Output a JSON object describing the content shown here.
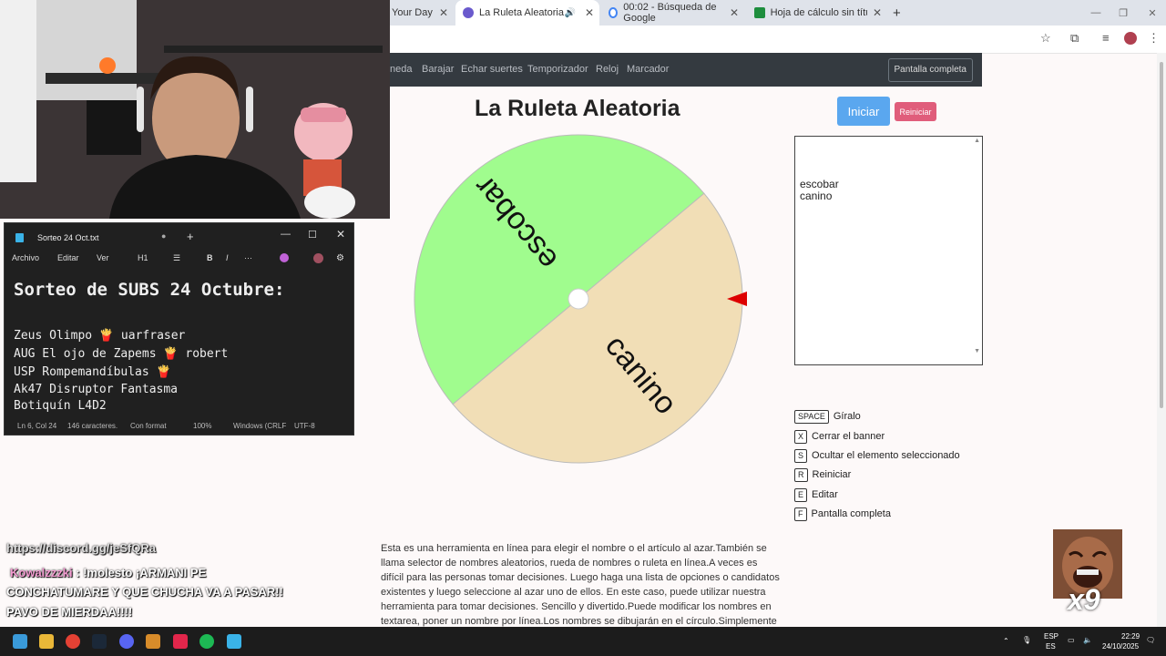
{
  "browser": {
    "tabs": [
      {
        "label": "Your Day"
      },
      {
        "label": "La Ruleta Aleatoria"
      },
      {
        "label": "00:02 - Búsqueda de Google"
      },
      {
        "label": "Hoja de cálculo sin título - Hoj"
      }
    ],
    "new_tab": "+"
  },
  "site_nav": {
    "items": [
      "neda",
      "Barajar",
      "Echar suertes",
      "Temporizador",
      "Reloj",
      "Marcador"
    ],
    "fullscreen_label": "Pantalla completa"
  },
  "page": {
    "title": "La Ruleta Aleatoria",
    "start_label": "Iniciar",
    "reset_label": "Reiniciar"
  },
  "wheel": {
    "segments": [
      {
        "label": "escobar",
        "color": "#a0fc8e"
      },
      {
        "label": "canino",
        "color": "#f1deb6"
      }
    ],
    "pointer_color": "#dd0000"
  },
  "names_text": [
    "escobar",
    "canino"
  ],
  "shortcuts": [
    {
      "key": "SPACE",
      "label": "Gíralo"
    },
    {
      "key": "X",
      "label": "Cerrar el banner"
    },
    {
      "key": "S",
      "label": "Ocultar el elemento seleccionado"
    },
    {
      "key": "R",
      "label": "Reiniciar"
    },
    {
      "key": "E",
      "label": "Editar"
    },
    {
      "key": "F",
      "label": "Pantalla completa"
    }
  ],
  "description": "Esta es una herramienta en línea para elegir el nombre o el artículo al azar.También se llama selector de nombres aleatorios, rueda de nombres o ruleta en línea.A veces es difícil para las personas tomar decisiones. Luego haga una lista de opciones o candidatos existentes y luego seleccione al azar uno de ellos. En este caso, puede utilizar nuestra herramienta para tomar decisiones. Sencillo y divertido.Puede modificar los nombres en textarea, poner un nombre por línea.Los nombres se dibujarán en el círculo.Simplemente haga clic en la rueda",
  "notepad": {
    "title": "Sorteo 24 Oct.txt",
    "menu": [
      "Archivo",
      "Editar",
      "Ver"
    ],
    "heading_level": "H1",
    "heading": "Sorteo de SUBS 24 Octubre:",
    "lines": [
      "Zeus Olimpo 🍟 uarfraser",
      "AUG El ojo de Zapems 🍟 robert",
      "USP Rompemandíbulas 🍟",
      "Ak47 Disruptor Fantasma",
      "Botiquín L4D2"
    ],
    "status": {
      "position": "Ln 6, Col 24",
      "chars": "146 caracteres.",
      "format": "Con format",
      "zoom": "100%",
      "eol": "Windows (CRLF",
      "encoding": "UTF-8"
    }
  },
  "chat": {
    "link": "https://discord.gg/jeSfQRa",
    "user": "Kowalzzzki",
    "message_lines": [
      ": !molesto ¡ARMANI PE",
      "CONCHATUMARE Y QUE CHUCHA VA A PASAR!!",
      "PAVO DE MIERDAA!!!!"
    ]
  },
  "emote": {
    "count": "x9"
  },
  "taskbar": {
    "lang_top": "ESP",
    "lang_bottom": "ES",
    "time": "22:29",
    "date": "24/10/2025"
  }
}
